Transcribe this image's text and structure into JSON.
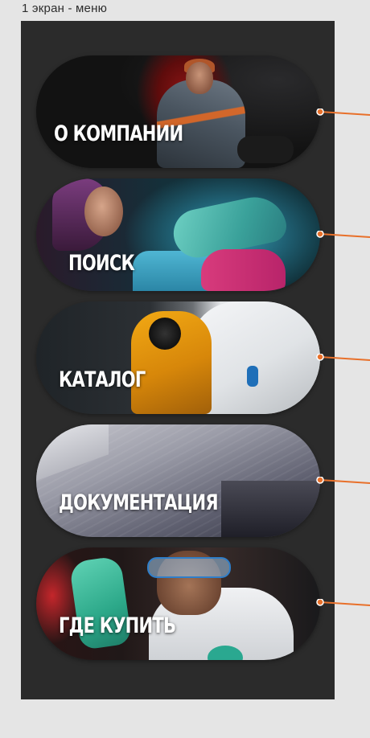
{
  "frame": {
    "title": "1 экран - меню"
  },
  "menu": {
    "items": [
      {
        "label": "О КОМПАНИИ"
      },
      {
        "label": "ПОИСК"
      },
      {
        "label": "КАТАЛОГ"
      },
      {
        "label": "ДОКУМЕНТАЦИЯ"
      },
      {
        "label": "ГДЕ КУПИТЬ"
      }
    ]
  },
  "colors": {
    "canvas": "#e5e5e5",
    "panel": "#2b2b2b",
    "connector": "#e8702a",
    "label_text": "#ffffff"
  }
}
